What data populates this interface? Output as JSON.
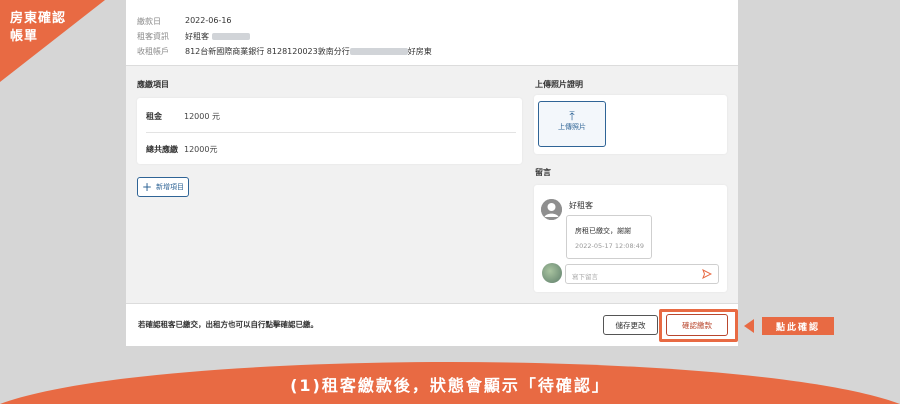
{
  "corner": {
    "line1": "房東確認",
    "line2": "帳單"
  },
  "info": {
    "pay_date_label": "繳款日",
    "pay_date_value": "2022-06-16",
    "tenant_label": "租客資訊",
    "tenant_value": "好租客",
    "account_label": "收租帳戶",
    "account_value_start": "812台新國際商業銀行 8128120023敦南分行",
    "account_value_end": "好房東"
  },
  "fees": {
    "section_title": "應繳項目",
    "rent_label": "租金",
    "rent_value": "12000 元",
    "total_label": "總共應繳",
    "total_value": "12000元",
    "add_label": "新增項目"
  },
  "upload": {
    "section_title": "上傳照片證明",
    "button_label": "上傳照片"
  },
  "comments": {
    "section_title": "留言",
    "author": "好租客",
    "message": "房租已繳交，謝謝",
    "timestamp": "2022-05-17 12:08:49",
    "input_placeholder": "寫下留言"
  },
  "footer": {
    "note": "若確認租客已繳交，出租方也可以自行點擊確認已繳。",
    "save_label": "儲存更改",
    "confirm_label": "確認繳款"
  },
  "callout": {
    "label": "點此確認"
  },
  "banner": {
    "caption": "(1)租客繳款後，狀態會顯示「待確認」"
  },
  "colors": {
    "accent": "#e86a43",
    "primary": "#2f6496",
    "confirm": "#b9472e"
  }
}
